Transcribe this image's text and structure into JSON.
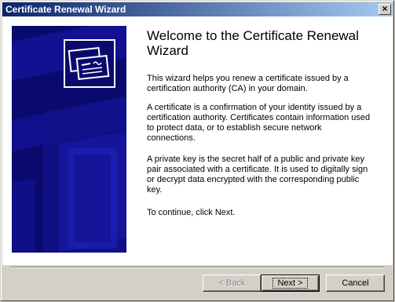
{
  "window": {
    "title": "Certificate Renewal Wizard",
    "close_glyph": "×"
  },
  "side_panel": {
    "icon": "certificate-icon",
    "colors": {
      "background": "#0a0a6e",
      "shapes": "#1a1aa0"
    }
  },
  "main": {
    "heading": "Welcome to the Certificate Renewal Wizard",
    "paragraphs": [
      "This wizard helps you renew a certificate issued by a certification authority (CA) in your domain.",
      "A certificate is a confirmation of your identity issued by a certification authority.  Certificates contain information used to protect data, or to establish secure network connections.",
      "A private key is the secret half of a public and private key pair associated with a certificate.  It is used to digitally sign or decrypt data encrypted with the corresponding public key.",
      "To continue, click Next."
    ]
  },
  "buttons": {
    "back": "< Back",
    "next": "Next >",
    "cancel": "Cancel"
  }
}
